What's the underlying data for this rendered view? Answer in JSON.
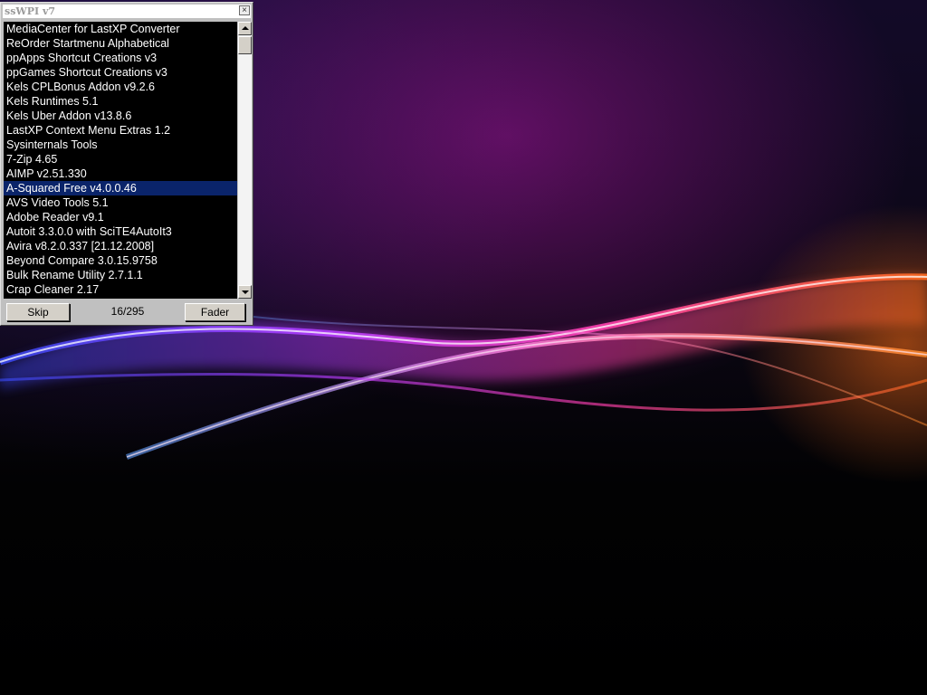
{
  "window": {
    "title": "ssWPI v7",
    "close_glyph": "×"
  },
  "list": {
    "items": [
      "MediaCenter for LastXP Converter",
      "ReOrder Startmenu Alphabetical",
      "ppApps Shortcut Creations v3",
      "ppGames Shortcut Creations v3",
      "Kels CPLBonus Addon v9.2.6",
      "Kels Runtimes 5.1",
      "Kels Uber Addon v13.8.6",
      "LastXP Context Menu Extras 1.2",
      "Sysinternals Tools",
      "7-Zip 4.65",
      "AIMP v2.51.330",
      "A-Squared Free v4.0.0.46",
      "AVS Video Tools 5.1",
      "Adobe Reader v9.1",
      "Autoit 3.3.0.0 with SciTE4AutoIt3",
      "Avira v8.2.0.337 [21.12.2008]",
      "Beyond Compare 3.0.15.9758",
      "Bulk Rename Utility 2.7.1.1",
      "Crap Cleaner 2.17"
    ],
    "selected_index": 11
  },
  "controls": {
    "skip_label": "Skip",
    "fader_label": "Fader",
    "progress_text": "16/295"
  },
  "icons": {
    "scroll_up": "scroll-up-arrow-icon",
    "scroll_down": "scroll-down-arrow-icon"
  },
  "colors": {
    "selection": "#0a246a",
    "list_background": "#000000",
    "list_text": "#ffffff"
  }
}
